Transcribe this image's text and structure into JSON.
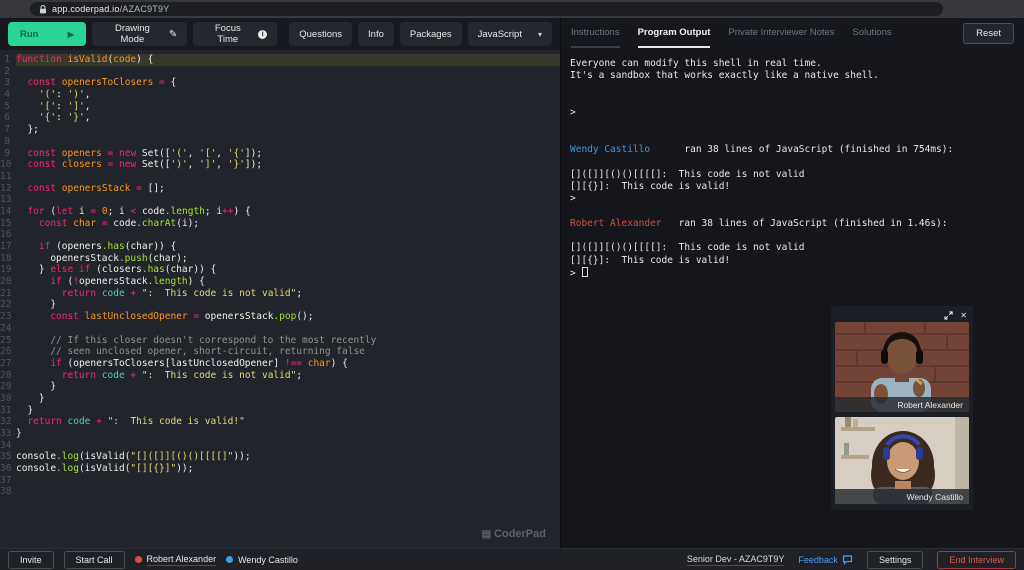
{
  "browser": {
    "url_domain": "app.coderpad.io",
    "url_path": "/AZAC9T9Y"
  },
  "toolbar": {
    "run_label": "Run",
    "drawing_mode_label": "Drawing Mode",
    "focus_time_label": "Focus Time",
    "questions_label": "Questions",
    "info_label": "Info",
    "packages_label": "Packages",
    "language_label": "JavaScript"
  },
  "editor": {
    "active_line": 1,
    "watermark": "CoderPad",
    "lines": [
      [
        [
          "k",
          "function "
        ],
        [
          "v",
          "isValid"
        ],
        [
          "w",
          "("
        ],
        [
          "v",
          "code"
        ],
        [
          "w",
          ") {"
        ]
      ],
      [],
      [
        [
          "w",
          "  "
        ],
        [
          "k",
          "const "
        ],
        [
          "v",
          "openersToClosers"
        ],
        [
          "o",
          " = "
        ],
        [
          "w",
          "{"
        ]
      ],
      [
        [
          "w",
          "    "
        ],
        [
          "s",
          "'('"
        ],
        [
          "w",
          ": "
        ],
        [
          "s",
          "')'"
        ],
        [
          "w",
          ","
        ]
      ],
      [
        [
          "w",
          "    "
        ],
        [
          "s",
          "'['"
        ],
        [
          "w",
          ": "
        ],
        [
          "s",
          "']'"
        ],
        [
          "w",
          ","
        ]
      ],
      [
        [
          "w",
          "    "
        ],
        [
          "s",
          "'{'"
        ],
        [
          "w",
          ": "
        ],
        [
          "s",
          "'}'"
        ],
        [
          "w",
          ","
        ]
      ],
      [
        [
          "w",
          "  };"
        ]
      ],
      [],
      [
        [
          "w",
          "  "
        ],
        [
          "k",
          "const "
        ],
        [
          "v",
          "openers"
        ],
        [
          "o",
          " = "
        ],
        [
          "k",
          "new "
        ],
        [
          "w",
          "Set(["
        ],
        [
          "s",
          "'('"
        ],
        [
          "w",
          ", "
        ],
        [
          "s",
          "'['"
        ],
        [
          "w",
          ", "
        ],
        [
          "s",
          "'{'"
        ],
        [
          "w",
          "]);"
        ]
      ],
      [
        [
          "w",
          "  "
        ],
        [
          "k",
          "const "
        ],
        [
          "v",
          "closers"
        ],
        [
          "o",
          " = "
        ],
        [
          "k",
          "new "
        ],
        [
          "w",
          "Set(["
        ],
        [
          "s",
          "')'"
        ],
        [
          "w",
          ", "
        ],
        [
          "s",
          "']'"
        ],
        [
          "w",
          ", "
        ],
        [
          "s",
          "'}'"
        ],
        [
          "w",
          "]);"
        ]
      ],
      [],
      [
        [
          "w",
          "  "
        ],
        [
          "k",
          "const "
        ],
        [
          "v",
          "openersStack"
        ],
        [
          "o",
          " = "
        ],
        [
          "w",
          "[];"
        ]
      ],
      [],
      [
        [
          "w",
          "  "
        ],
        [
          "k",
          "for "
        ],
        [
          "w",
          "("
        ],
        [
          "k",
          "let "
        ],
        [
          "w",
          "i"
        ],
        [
          "o",
          " = "
        ],
        [
          "v",
          "0"
        ],
        [
          "w",
          "; i "
        ],
        [
          "o",
          "<"
        ],
        [
          "w",
          " code"
        ],
        [
          "m",
          ".length"
        ],
        [
          "w",
          "; i"
        ],
        [
          "o",
          "++"
        ],
        [
          "w",
          ") {"
        ]
      ],
      [
        [
          "w",
          "    "
        ],
        [
          "k",
          "const "
        ],
        [
          "v",
          "char"
        ],
        [
          "o",
          " = "
        ],
        [
          "w",
          "code"
        ],
        [
          "m",
          ".charAt"
        ],
        [
          "w",
          "(i);"
        ]
      ],
      [],
      [
        [
          "w",
          "    "
        ],
        [
          "k",
          "if "
        ],
        [
          "w",
          "(openers"
        ],
        [
          "m",
          ".has"
        ],
        [
          "w",
          "(char)) {"
        ]
      ],
      [
        [
          "w",
          "      openersStack"
        ],
        [
          "m",
          ".push"
        ],
        [
          "w",
          "(char);"
        ]
      ],
      [
        [
          "w",
          "    } "
        ],
        [
          "k",
          "else if "
        ],
        [
          "w",
          "(closers"
        ],
        [
          "m",
          ".has"
        ],
        [
          "w",
          "(char)) {"
        ]
      ],
      [
        [
          "w",
          "      "
        ],
        [
          "k",
          "if "
        ],
        [
          "w",
          "("
        ],
        [
          "o",
          "!"
        ],
        [
          "w",
          "openersStack"
        ],
        [
          "m",
          ".length"
        ],
        [
          "w",
          ") {"
        ]
      ],
      [
        [
          "w",
          "        "
        ],
        [
          "k",
          "return "
        ],
        [
          "t",
          "code"
        ],
        [
          "o",
          " + "
        ],
        [
          "s",
          "\":  This code is not valid\""
        ],
        [
          "w",
          ";"
        ]
      ],
      [
        [
          "w",
          "      }"
        ]
      ],
      [
        [
          "w",
          "      "
        ],
        [
          "k",
          "const "
        ],
        [
          "v",
          "lastUnclosedOpener"
        ],
        [
          "o",
          " = "
        ],
        [
          "w",
          "openersStack"
        ],
        [
          "m",
          ".pop"
        ],
        [
          "w",
          "();"
        ]
      ],
      [],
      [
        [
          "c",
          "      // If this closer doesn't correspond to the most recently"
        ]
      ],
      [
        [
          "c",
          "      // seen unclosed opener, short-circuit, returning false"
        ]
      ],
      [
        [
          "w",
          "      "
        ],
        [
          "k",
          "if "
        ],
        [
          "w",
          "(openersToClosers[lastUnclosedOpener] "
        ],
        [
          "o",
          "!== "
        ],
        [
          "v",
          "char"
        ],
        [
          "w",
          ") {"
        ]
      ],
      [
        [
          "w",
          "        "
        ],
        [
          "k",
          "return "
        ],
        [
          "t",
          "code"
        ],
        [
          "o",
          " + "
        ],
        [
          "s",
          "\":  This code is not valid\""
        ],
        [
          "w",
          ";"
        ]
      ],
      [
        [
          "w",
          "      }"
        ]
      ],
      [
        [
          "w",
          "    }"
        ]
      ],
      [
        [
          "w",
          "  }"
        ]
      ],
      [
        [
          "w",
          "  "
        ],
        [
          "k",
          "return "
        ],
        [
          "t",
          "code"
        ],
        [
          "o",
          " + "
        ],
        [
          "s",
          "\":  This code is valid!\""
        ]
      ],
      [
        [
          "w",
          "}"
        ]
      ],
      [],
      [
        [
          "w",
          "console"
        ],
        [
          "m",
          ".log"
        ],
        [
          "w",
          "(isValid("
        ],
        [
          "s",
          "\"[]([]][()()[[[[]\""
        ],
        [
          "w",
          "));"
        ]
      ],
      [
        [
          "w",
          "console"
        ],
        [
          "m",
          ".log"
        ],
        [
          "w",
          "(isValid("
        ],
        [
          "s",
          "\"[][{}]\""
        ],
        [
          "w",
          "));"
        ]
      ],
      [],
      []
    ]
  },
  "right_panel": {
    "tabs": [
      {
        "label": "Instructions",
        "active": false
      },
      {
        "label": "Program Output",
        "active": true
      },
      {
        "label": "Private Interviewer Notes",
        "active": false
      },
      {
        "label": "Solutions",
        "active": false
      }
    ],
    "reset_label": "Reset",
    "output_lines": [
      [
        [
          "p",
          "Everyone can modify this shell in real time."
        ]
      ],
      [
        [
          "p",
          "It's a sandbox that works exactly like a native shell."
        ]
      ],
      [],
      [],
      [
        [
          "p",
          ">"
        ]
      ],
      [],
      [],
      [
        [
          "blue",
          "Wendy Castillo"
        ],
        [
          "p",
          "      ran 38 lines of JavaScript (finished in 754ms):"
        ]
      ],
      [],
      [
        [
          "p",
          "[]([]][()()[[[[]:  This code is not valid"
        ]
      ],
      [
        [
          "p",
          "[][{}]:  This code is valid!"
        ]
      ],
      [
        [
          "p",
          ">"
        ]
      ],
      [],
      [
        [
          "red",
          "Robert Alexander"
        ],
        [
          "p",
          "   ran 38 lines of JavaScript (finished in 1.46s):"
        ]
      ],
      [],
      [
        [
          "p",
          "[]([]][()()[[[[]:  This code is not valid"
        ]
      ],
      [
        [
          "p",
          "[][{}]:  This code is valid!"
        ]
      ],
      [
        [
          "p",
          "> "
        ],
        [
          "cursor",
          ""
        ]
      ]
    ]
  },
  "videos": {
    "participant1": "Robert Alexander",
    "participant2": "Wendy Castillo"
  },
  "bottom_bar": {
    "invite_label": "Invite",
    "start_call_label": "Start Call",
    "user1": "Robert Alexander",
    "user2": "Wendy Castillo",
    "session_title": "Senior Dev - AZAC9T9Y",
    "feedback_label": "Feedback",
    "settings_label": "Settings",
    "end_interview_label": "End Interview"
  },
  "colors": {
    "run_green": "#2bd394",
    "user1_dot": "#e04b3f",
    "user2_dot": "#3f9ce8",
    "feedback_blue": "#4a9eff",
    "end_red": "#e0574b"
  }
}
